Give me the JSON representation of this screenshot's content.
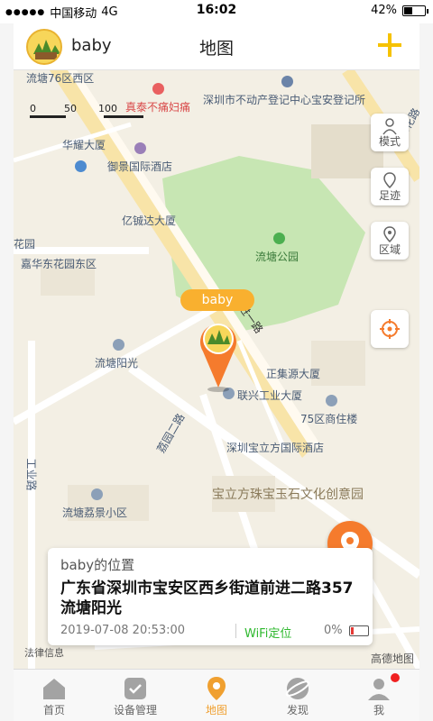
{
  "status_bar": {
    "carrier": "中国移动",
    "network": "4G",
    "time": "16:02",
    "battery": "42%"
  },
  "header": {
    "name": "baby",
    "title": "地图"
  },
  "map": {
    "scale": {
      "t0": "0",
      "t1": "50",
      "t2": "100"
    },
    "labels": {
      "l1": "流塘76区西区",
      "l2": "真泰不痛妇痛",
      "l3": "深圳市不动产登记中心宝安登记所",
      "l4": "华耀大厦",
      "l5": "御景国际酒店",
      "l6": "亿铖达大厦",
      "l7": "流塘公园",
      "l8": "嘉华东花园东区",
      "l9": "花园",
      "l10": "流塘阳光",
      "l11": "正集源大厦",
      "l12": "联兴工业大厦",
      "l13": "75区商住楼",
      "l14": "深圳宝立方国际酒店",
      "l15": "宝立方珠宝玉石文化创意园",
      "l16": "流塘荔景小区",
      "l17": "前进一路",
      "l18": "荔园二路",
      "l19": "工业路",
      "l20": "锦花路"
    },
    "buttons": {
      "mode": "模式",
      "footprint": "足迹",
      "region": "区域"
    },
    "marker_label": "baby",
    "legal": "法律信息",
    "logo": "高德地图"
  },
  "info_card": {
    "title": "baby的位置",
    "address": "广东省深圳市宝安区西乡街道前进二路357流塘阳光",
    "time": "2019-07-08 20:53:00",
    "locate_type": "WiFi定位",
    "battery_pct": "0%"
  },
  "tabs": [
    {
      "label": "首页",
      "icon": "home-icon"
    },
    {
      "label": "设备管理",
      "icon": "device-icon"
    },
    {
      "label": "地图",
      "icon": "map-pin-icon"
    },
    {
      "label": "发现",
      "icon": "discover-icon"
    },
    {
      "label": "我",
      "icon": "user-icon"
    }
  ],
  "colors": {
    "accent": "#f6c200",
    "marker": "#f57b2d",
    "park": "#c4e4b0"
  }
}
